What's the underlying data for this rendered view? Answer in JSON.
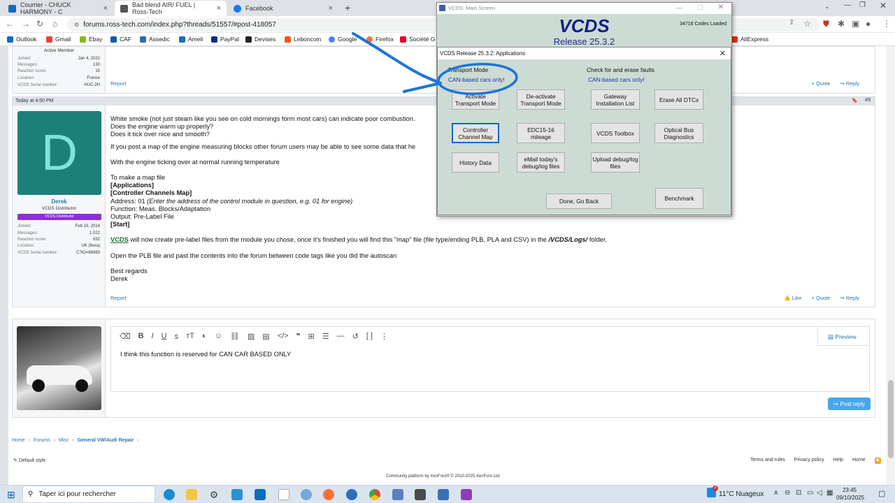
{
  "tabs": [
    {
      "title": "Courrier - CHUCK HARMONY - C",
      "color": "#0f6cbd"
    },
    {
      "title": "Bad blend AIR/ FUEL | Ross-Tech",
      "color": "#555555"
    },
    {
      "title": "Facebook",
      "color": "#1877f2"
    }
  ],
  "new_tab": "+",
  "url": "forums.ross-tech.com/index.php?threads/51557/#post-418057",
  "bookmarks": [
    "Outlook",
    "Gmail",
    "Ebay",
    "CAF",
    "Assedic",
    "Ameli",
    "PayPal",
    "Devises",
    "Leboncoin",
    "Google",
    "Firefox",
    "Société G",
    "AliExpress"
  ],
  "post1": {
    "role": "Active Member",
    "stats": [
      [
        "Joined:",
        "Jan 4, 2022"
      ],
      [
        "Messages:",
        "130"
      ],
      [
        "Reaction score:",
        "15"
      ],
      [
        "Location:",
        "France"
      ],
      [
        "VCDS Serial number:",
        "HUC-2H"
      ]
    ],
    "report": "Report",
    "quote": "+ Quote",
    "reply": "↪ Reply"
  },
  "post2": {
    "date": "Today at 4:50 PM",
    "num": "#9",
    "avatar_letter": "D",
    "avatar_color": "#1d7f7a",
    "username": "Derek",
    "title": "VCDS Distributor",
    "badge": "VCDS Distributor",
    "stats": [
      [
        "Joined:",
        "Feb 19, 2014"
      ],
      [
        "Messages:",
        "1,022"
      ],
      [
        "Reaction score:",
        "832"
      ],
      [
        "Location:",
        "UK (Ilexa)"
      ],
      [
        "VCDS Serial number:",
        "C?iO=66983"
      ]
    ],
    "lines": {
      "l1": "White smoke (not just steam like you see on cold mornings form most cars) can indicate poor combustion.",
      "l2": "Does the engine warm up properly?",
      "l3": "Does it tick over nice and smooth?",
      "l4": "If you post a map of the engine measuring blocks other forum users may be able to see some data that he",
      "l5": "With the engine ticking over at normal running temperature",
      "l6": "To make a map file",
      "l7": "[Applications]",
      "l8": "[Controller Channels Map]",
      "l9a": "Address: 01 ",
      "l9b": "(Enter the address of the control module in question, e.g. 01 for engine)",
      "l10": "Function: Meas. Blocks/Adaptation",
      "l11": "Output: Pre-Label File",
      "l12": "[Start]",
      "l13a": "VCDS",
      "l13b": " will now create pre-label files from the module you chose, once it's finished you will find this \"map\" file (file type/ending PLB, PLA and CSV) in the ",
      "l13c": "/VCDS/Logs/",
      "l13d": " folder.",
      "l14": "Open the PLB file and past the contents into the forum between code tags like you did the autoscan",
      "l15": "Best regards",
      "l16": "Derek"
    },
    "report": "Report",
    "like": "👍 Like",
    "quote": "+ Quote",
    "reply": "↪ Reply"
  },
  "editor": {
    "text": "I think this function is reserved for CAN CAR BASED ONLY",
    "preview": "Preview",
    "post_reply": "Post reply"
  },
  "breadcrumb": [
    "Home",
    "Forums",
    "Misc",
    "General VW/Audi Repair"
  ],
  "footer": {
    "style": "Default style",
    "links": [
      "Terms and rules",
      "Privacy policy",
      "Help",
      "Home"
    ],
    "platform": "Community platform by XenForo® © 2010-2025 XenForo Ltd."
  },
  "vcds_main": {
    "title": "VCDS:  Main Screen",
    "brand": "VCDS",
    "release": "Release 25.3.2",
    "codes": "34716 Codes Loaded"
  },
  "vcds_apps": {
    "title": "VCDS Release 25.3.2:  Applications",
    "transport_label": "Transport Mode",
    "transport_note": "CAN-based cars only!",
    "faults_label": "Check for and erase faults",
    "faults_note": "CAN-based cars only!",
    "buttons": {
      "activate": "Activate Transport Mode",
      "deactivate": "De-activate Transport Mode",
      "gateway": "Gateway Installation List",
      "erase": "Erase All DTCs",
      "channel": "Controller Channel Map",
      "edc": "EDC15-16 mileage",
      "toolbox": "VCDS Toolbox",
      "optical": "Optical Bus Diagnostics",
      "history": "History Data",
      "email": "eMail today's debug/log files",
      "upload": "Upload debug/log files",
      "done": "Done, Go Back",
      "bench": "Benchmark"
    }
  },
  "taskbar": {
    "search": "Taper ici pour rechercher",
    "weather": "11°C  Nuageux",
    "time": "23:45",
    "date": "09/10/2025",
    "notif": "2"
  }
}
